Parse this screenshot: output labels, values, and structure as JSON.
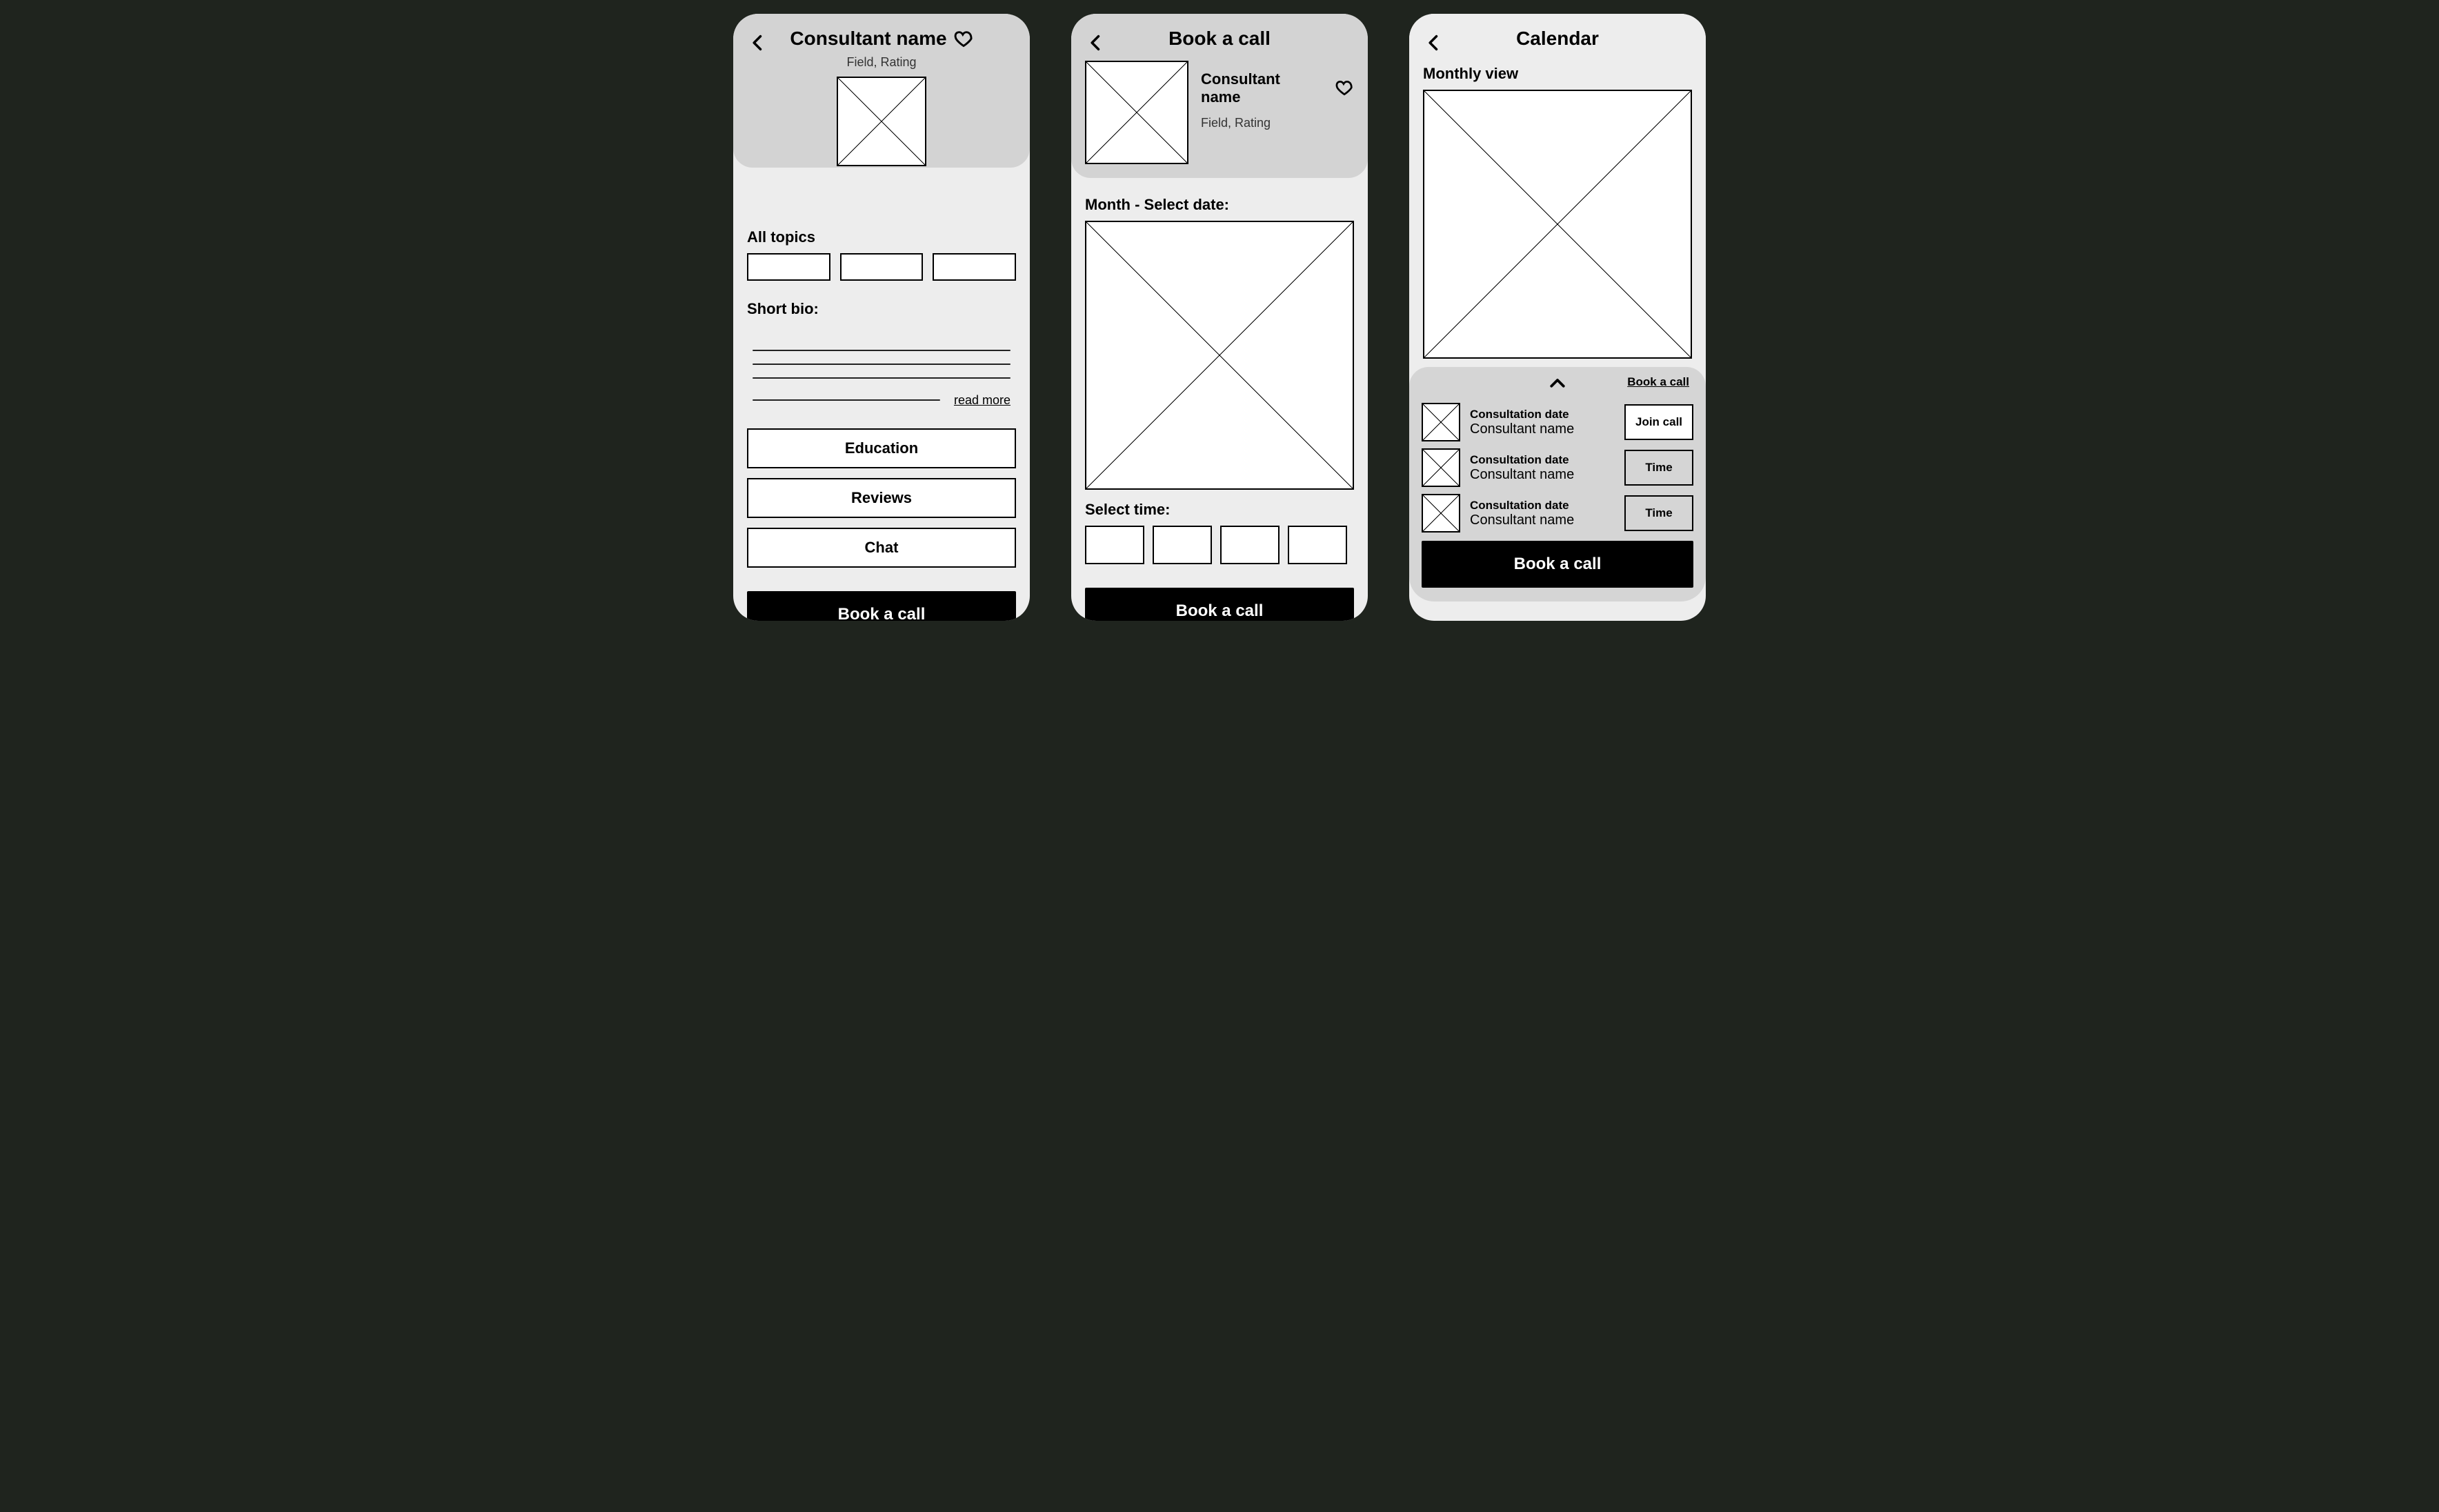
{
  "screen1": {
    "title": "Consultant name",
    "subtitle": "Field, Rating",
    "allTopicsLabel": "All topics",
    "shortBioLabel": "Short bio:",
    "readMore": "read more",
    "buttons": {
      "education": "Education",
      "reviews": "Reviews",
      "chat": "Chat",
      "book": "Book a call"
    }
  },
  "screen2": {
    "title": "Book a call",
    "consultant": {
      "name": "Consultant name",
      "sub": "Field, Rating"
    },
    "monthLabel": "Month - Select date:",
    "selectTimeLabel": "Select time:",
    "book": "Book a call"
  },
  "screen3": {
    "title": "Calendar",
    "monthlyViewLabel": "Monthly view",
    "bookLink": "Book a call",
    "rows": [
      {
        "date": "Consultation date",
        "name": "Consultant name",
        "action": "Join call",
        "variant": "primary"
      },
      {
        "date": "Consultation date",
        "name": "Consultant name",
        "action": "Time",
        "variant": "secondary"
      },
      {
        "date": "Consultation date",
        "name": "Consultant name",
        "action": "Time",
        "variant": "secondary"
      }
    ],
    "book": "Book a call"
  }
}
